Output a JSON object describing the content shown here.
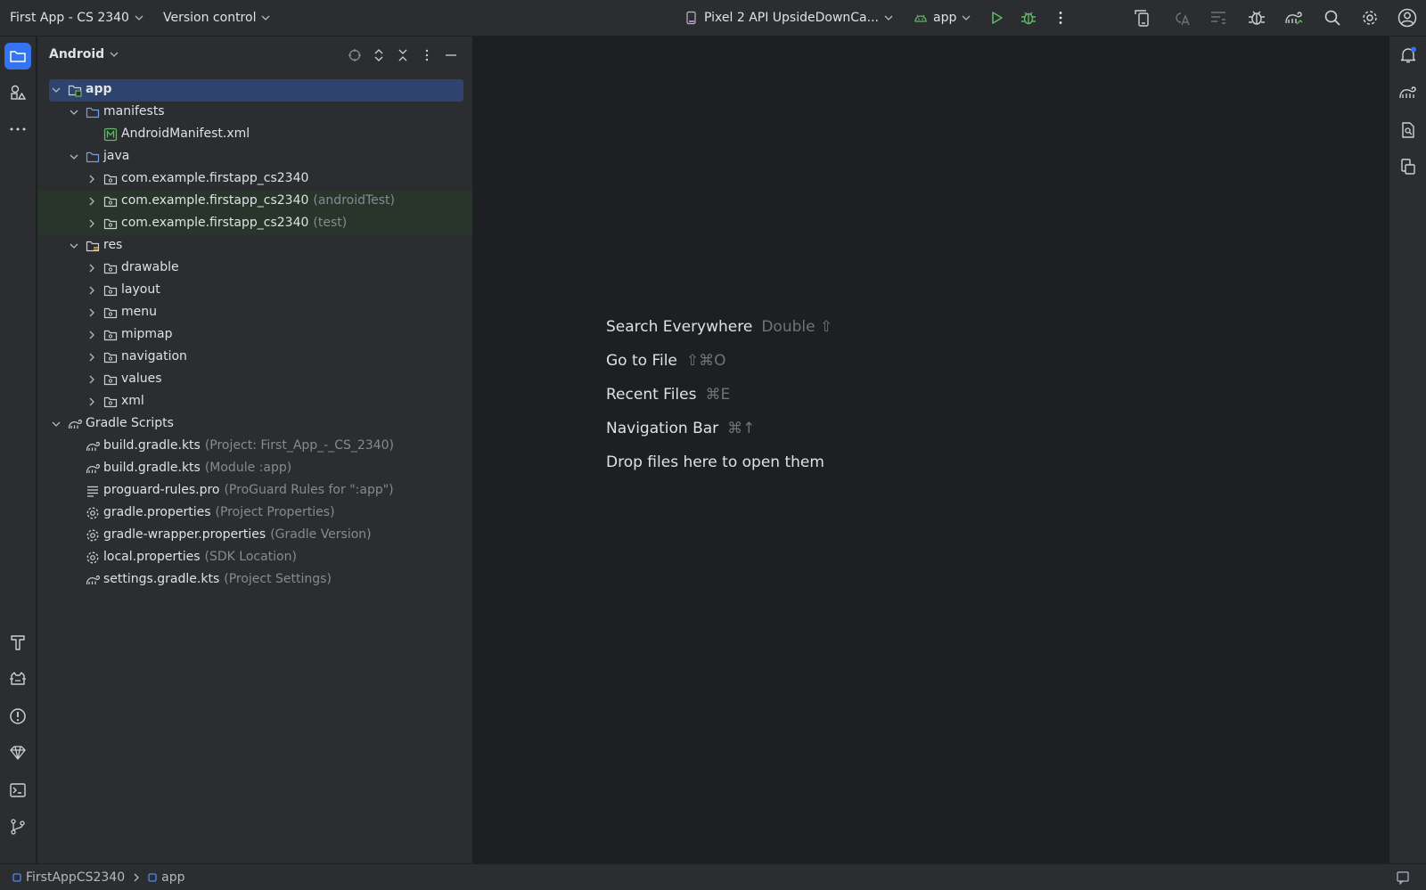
{
  "toolbar": {
    "project": "First App - CS 2340",
    "version_control": "Version control",
    "device": "Pixel 2 API UpsideDownCa...",
    "run_config": "app",
    "icons": [
      "device-manager-icon",
      "translate-icon",
      "tasks-icon",
      "debug-icon",
      "gradle-sync-icon",
      "search-icon",
      "settings-icon",
      "account-icon"
    ]
  },
  "left_stripe": [
    "project-icon",
    "resource-manager-icon",
    "more-icon",
    "build-icon",
    "logcat-icon",
    "problems-icon",
    "app-quality-icon",
    "terminal-icon",
    "version-control-icon"
  ],
  "right_stripe": [
    "notifications-icon",
    "gradle-icon",
    "device-file-explorer-icon",
    "running-devices-icon"
  ],
  "panel": {
    "title": "Android"
  },
  "tree": [
    {
      "label": "app",
      "hint": "",
      "depth": 0,
      "arrow": "down",
      "icon": "module"
    },
    {
      "label": "manifests",
      "hint": "",
      "depth": 1,
      "arrow": "down",
      "icon": "folder"
    },
    {
      "label": "AndroidManifest.xml",
      "hint": "",
      "depth": 2,
      "arrow": "",
      "icon": "manifest"
    },
    {
      "label": "java",
      "hint": "",
      "depth": 1,
      "arrow": "down",
      "icon": "folder"
    },
    {
      "label": "com.example.firstapp_cs2340",
      "hint": "",
      "depth": 2,
      "arrow": "right",
      "icon": "package"
    },
    {
      "label": "com.example.firstapp_cs2340",
      "hint": "(androidTest)",
      "depth": 2,
      "arrow": "right",
      "icon": "package"
    },
    {
      "label": "com.example.firstapp_cs2340",
      "hint": "(test)",
      "depth": 2,
      "arrow": "right",
      "icon": "package"
    },
    {
      "label": "res",
      "hint": "",
      "depth": 1,
      "arrow": "down",
      "icon": "resfolder"
    },
    {
      "label": "drawable",
      "hint": "",
      "depth": 2,
      "arrow": "right",
      "icon": "package"
    },
    {
      "label": "layout",
      "hint": "",
      "depth": 2,
      "arrow": "right",
      "icon": "package"
    },
    {
      "label": "menu",
      "hint": "",
      "depth": 2,
      "arrow": "right",
      "icon": "package"
    },
    {
      "label": "mipmap",
      "hint": "",
      "depth": 2,
      "arrow": "right",
      "icon": "package"
    },
    {
      "label": "navigation",
      "hint": "",
      "depth": 2,
      "arrow": "right",
      "icon": "package"
    },
    {
      "label": "values",
      "hint": "",
      "depth": 2,
      "arrow": "right",
      "icon": "package"
    },
    {
      "label": "xml",
      "hint": "",
      "depth": 2,
      "arrow": "right",
      "icon": "package"
    },
    {
      "label": "Gradle Scripts",
      "hint": "",
      "depth": 0,
      "arrow": "down",
      "icon": "gradle"
    },
    {
      "label": "build.gradle.kts",
      "hint": "(Project: First_App_-_CS_2340)",
      "depth": 1,
      "arrow": "",
      "icon": "gradle"
    },
    {
      "label": "build.gradle.kts",
      "hint": "(Module :app)",
      "depth": 1,
      "arrow": "",
      "icon": "gradle"
    },
    {
      "label": "proguard-rules.pro",
      "hint": "(ProGuard Rules for \":app\")",
      "depth": 1,
      "arrow": "",
      "icon": "text"
    },
    {
      "label": "gradle.properties",
      "hint": "(Project Properties)",
      "depth": 1,
      "arrow": "",
      "icon": "gear"
    },
    {
      "label": "gradle-wrapper.properties",
      "hint": "(Gradle Version)",
      "depth": 1,
      "arrow": "",
      "icon": "gear"
    },
    {
      "label": "local.properties",
      "hint": "(SDK Location)",
      "depth": 1,
      "arrow": "",
      "icon": "gear"
    },
    {
      "label": "settings.gradle.kts",
      "hint": "(Project Settings)",
      "depth": 1,
      "arrow": "",
      "icon": "gradle"
    }
  ],
  "editor_hints": [
    {
      "label": "Search Everywhere",
      "shortcut": "Double ⇧"
    },
    {
      "label": "Go to File",
      "shortcut": "⇧⌘O"
    },
    {
      "label": "Recent Files",
      "shortcut": "⌘E"
    },
    {
      "label": "Navigation Bar",
      "shortcut": "⌘↑"
    },
    {
      "label": "Drop files here to open them",
      "shortcut": ""
    }
  ],
  "statusbar": {
    "breadcrumb": [
      "FirstAppCS2340",
      "app"
    ]
  }
}
